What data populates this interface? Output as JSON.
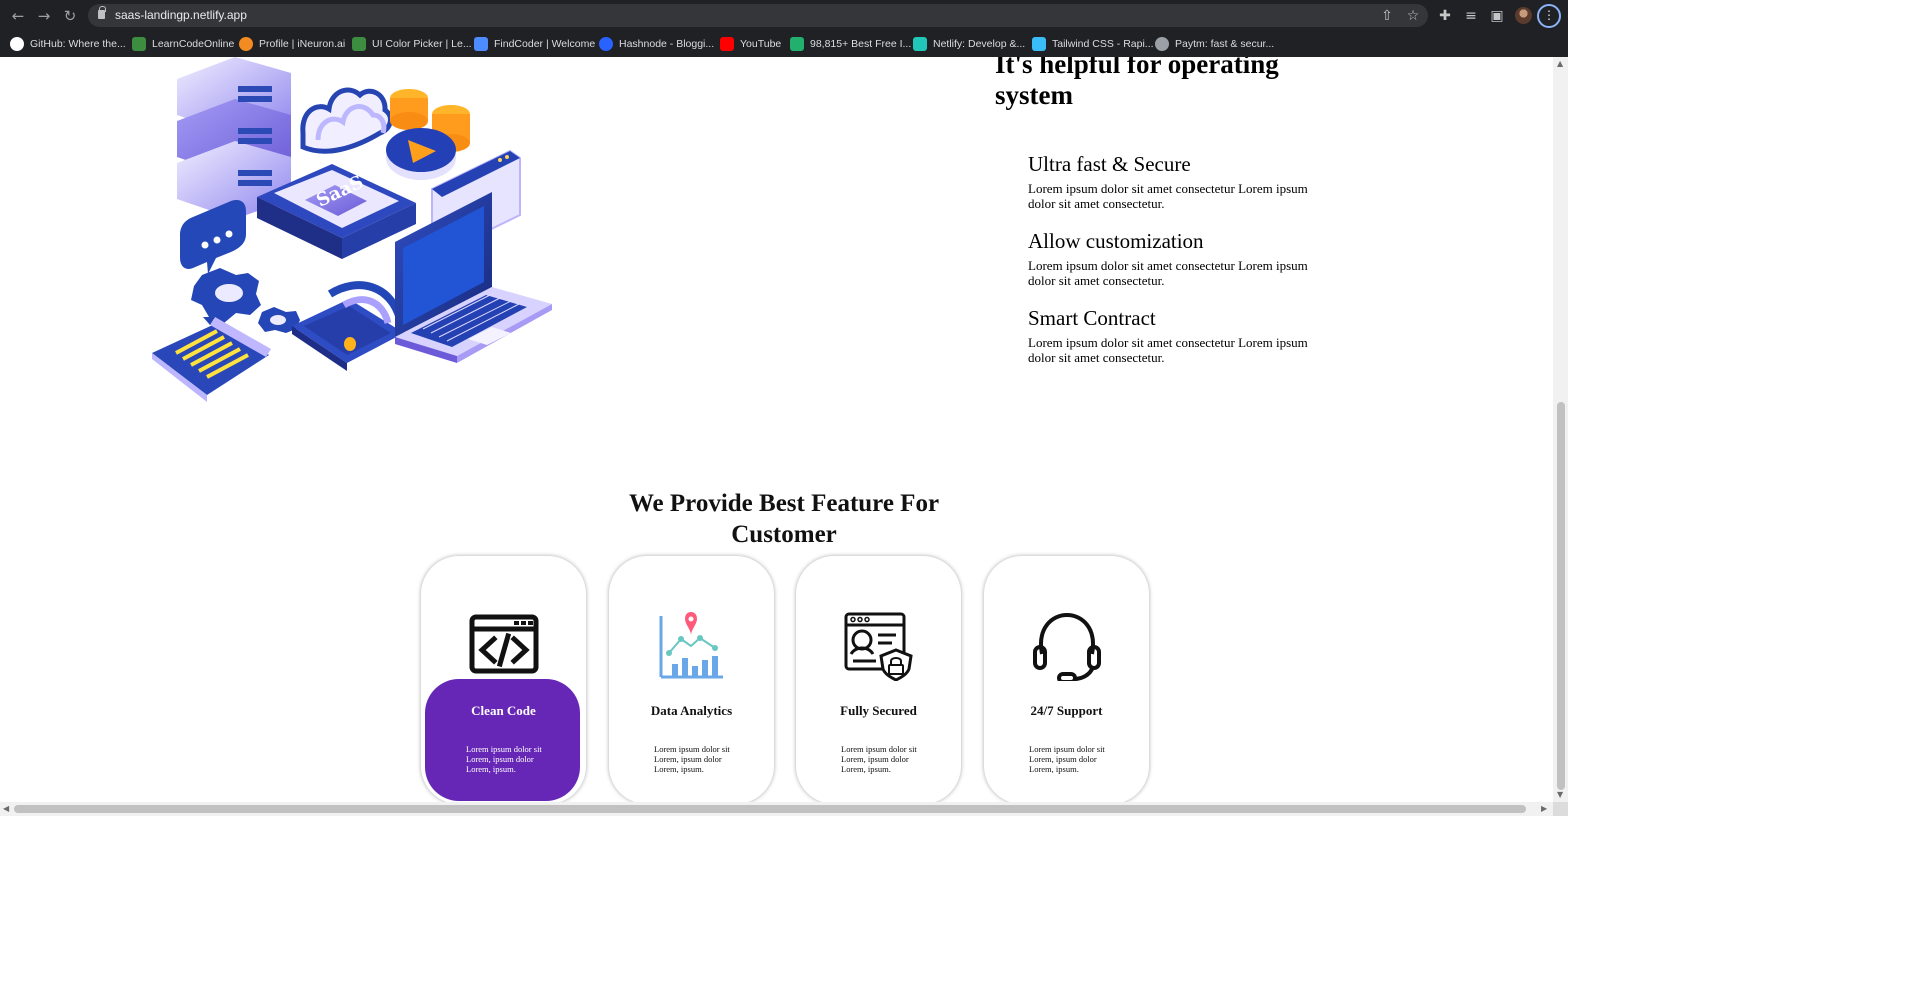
{
  "browser": {
    "url": "saas-landingp.netlify.app",
    "nav_icons": [
      "back-arrow-icon",
      "forward-arrow-icon",
      "reload-icon"
    ],
    "toolbar_icons": [
      "share-icon",
      "star-icon",
      "extensions-icon",
      "media-icon",
      "side-panel-icon",
      "profile-icon",
      "chrome-menu-icon"
    ],
    "bookmarks": [
      {
        "label": "GitHub: Where the...",
        "icon": "github-icon",
        "color": "#ffffff"
      },
      {
        "label": "LearnCodeOnline",
        "icon": "learncodeonline-icon",
        "color": "#9aa0a6"
      },
      {
        "label": "Profile | iNeuron.ai",
        "icon": "ineuron-icon",
        "color": "#f28b22"
      },
      {
        "label": "UI Color Picker | Le...",
        "icon": "ui-color-picker-icon",
        "color": "#4caf50"
      },
      {
        "label": "FindCoder | Welcome",
        "icon": "findcoder-icon",
        "color": "#4d8cff"
      },
      {
        "label": "Hashnode - Bloggi...",
        "icon": "hashnode-icon",
        "color": "#2962ff"
      },
      {
        "label": "YouTube",
        "icon": "youtube-icon",
        "color": "#ff0000"
      },
      {
        "label": "98,815+ Best Free I...",
        "icon": "freepik-icon",
        "color": "#23b06e"
      },
      {
        "label": "Netlify: Develop &...",
        "icon": "netlify-icon",
        "color": "#20c6b7"
      },
      {
        "label": "Tailwind CSS - Rapi...",
        "icon": "tailwind-icon",
        "color": "#38bdf8"
      },
      {
        "label": "Paytm: fast & secur...",
        "icon": "paytm-icon",
        "color": "#9aa0a6"
      }
    ]
  },
  "page": {
    "illustration_label": "SaaS",
    "about": {
      "title": "It's helpful for operating system",
      "features": [
        {
          "title": "Ultra fast & Secure",
          "text": "Lorem ipsum dolor sit amet consectetur Lorem ipsum dolor sit amet consectetur."
        },
        {
          "title": "Allow customization",
          "text": "Lorem ipsum dolor sit amet consectetur Lorem ipsum dolor sit amet consectetur."
        },
        {
          "title": "Smart Contract",
          "text": "Lorem ipsum dolor sit amet consectetur Lorem ipsum dolor sit amet consectetur."
        }
      ]
    },
    "features_section": {
      "title": "We Provide Best Feature For Customer",
      "cards": [
        {
          "title": "Clean Code",
          "text": "Lorem ipsum dolor sit Lorem, ipsum dolor Lorem, ipsum.",
          "icon": "code-window-icon",
          "active": true
        },
        {
          "title": "Data Analytics",
          "text": "Lorem ipsum dolor sit Lorem, ipsum dolor Lorem, ipsum.",
          "icon": "analytics-chart-icon",
          "active": false
        },
        {
          "title": "Fully Secured",
          "text": "Lorem ipsum dolor sit Lorem, ipsum dolor Lorem, ipsum.",
          "icon": "security-profile-icon",
          "active": false
        },
        {
          "title": "24/7 Support",
          "text": "Lorem ipsum dolor sit Lorem, ipsum dolor Lorem, ipsum.",
          "icon": "headset-icon",
          "active": false
        }
      ]
    },
    "colors": {
      "browser_dark": "#202124",
      "active_card": "#6727b6",
      "analytics_teal": "#68c7c1",
      "analytics_blue": "#6aa7e8",
      "analytics_pin": "#ff5a7a"
    }
  }
}
